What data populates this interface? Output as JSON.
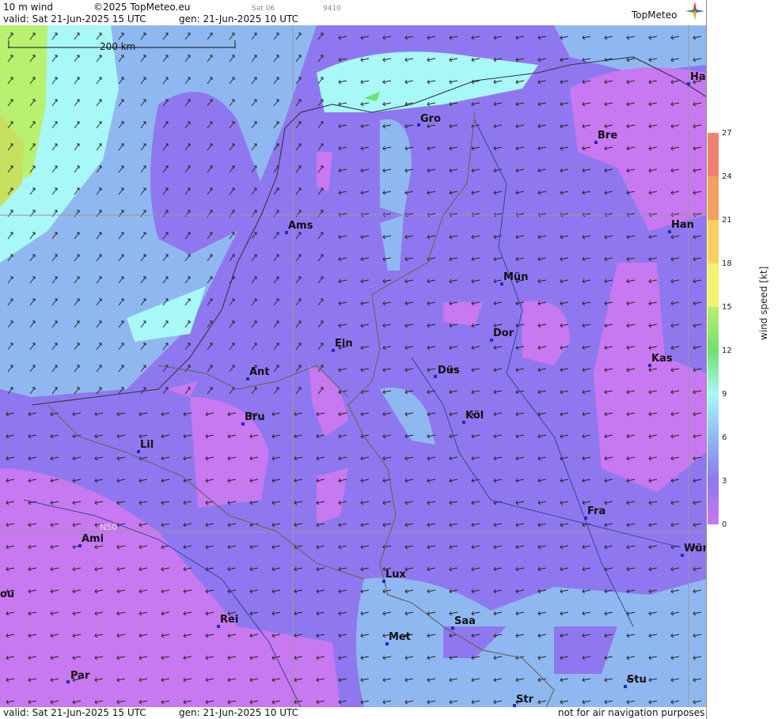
{
  "header": {
    "product": "10 m wind",
    "copyright": "©2025 TopMeteo.eu",
    "run_tag": "Sat 06",
    "code": "9410",
    "valid": "valid:  Sat  21-Jun-2025  15 UTC",
    "generated": "gen: 21-Jun-2025 10 UTC",
    "logo": "TopMeteo"
  },
  "map": {
    "scale_label": "200 km",
    "latitude_label": "N50",
    "cities": [
      {
        "name": "Ha"
      },
      {
        "name": "Gro"
      },
      {
        "name": "Bre"
      },
      {
        "name": "Ams"
      },
      {
        "name": "Han"
      },
      {
        "name": "Mün"
      },
      {
        "name": "Ein"
      },
      {
        "name": "Dor"
      },
      {
        "name": "Kas"
      },
      {
        "name": "Ant"
      },
      {
        "name": "Düs"
      },
      {
        "name": "Köl"
      },
      {
        "name": "Bru"
      },
      {
        "name": "Lil"
      },
      {
        "name": "Fra"
      },
      {
        "name": "Ami"
      },
      {
        "name": "Wür"
      },
      {
        "name": "Lux"
      },
      {
        "name": "ou"
      },
      {
        "name": "Rei"
      },
      {
        "name": "Saa"
      },
      {
        "name": "Met"
      },
      {
        "name": "Par"
      },
      {
        "name": "Stu"
      },
      {
        "name": "Str"
      }
    ]
  },
  "legend": {
    "title": "wind speed [kt]",
    "ticks": [
      "27",
      "24",
      "21",
      "18",
      "15",
      "12",
      "9",
      "6",
      "3",
      "0"
    ],
    "colors": [
      "#f08070",
      "#f4a060",
      "#f8d060",
      "#f4f070",
      "#b8f070",
      "#70e070",
      "#a8f8f8",
      "#90b8f0",
      "#8f78ef",
      "#c878f0"
    ]
  },
  "footer": {
    "valid": "valid:  Sat  21-Jun-2025  15 UTC",
    "generated": "gen: 21-Jun-2025 10 UTC",
    "disclaimer": "not for air navigation purposes"
  }
}
